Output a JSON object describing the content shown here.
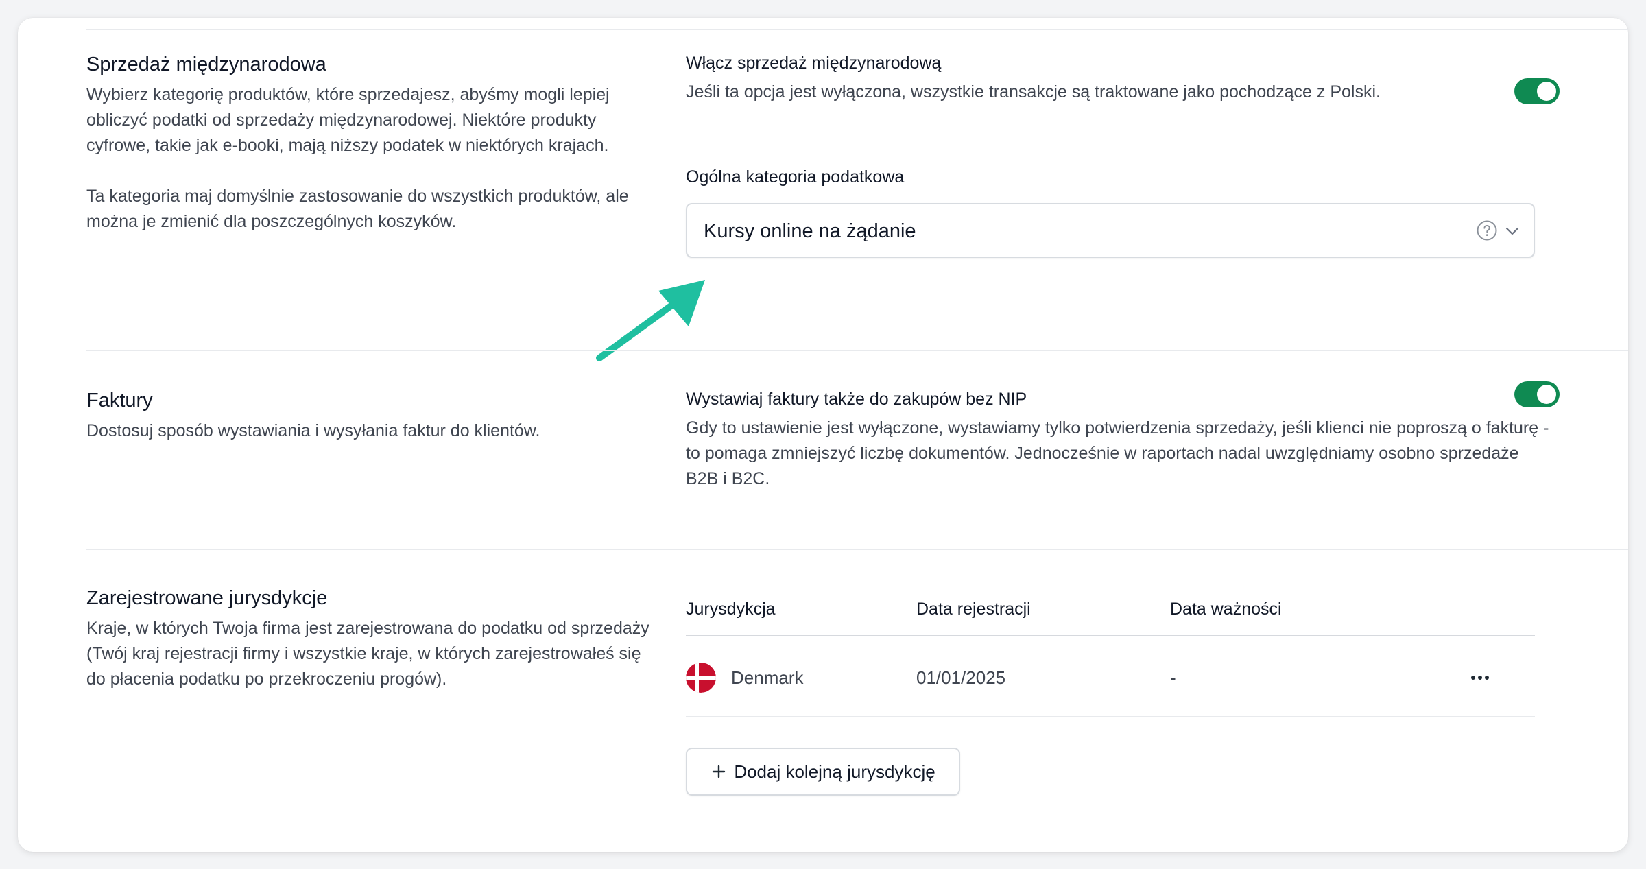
{
  "international": {
    "title": "Sprzedaż międzynarodowa",
    "description_1": "Wybierz kategorię produktów, które sprzedajesz, abyśmy mogli lepiej obliczyć podatki od sprzedaży międzynarodowej. Niektóre produkty cyfrowe, takie jak e-booki, mają niższy podatek w niektórych krajach.",
    "description_2": "Ta kategoria maj domyślnie zastosowanie do wszystkich produktów, ale można je zmienić dla poszczególnych koszyków.",
    "toggle_label": "Włącz sprzedaż międzynarodową",
    "toggle_description": "Jeśli ta opcja jest wyłączona, wszystkie transakcje są traktowane jako pochodzące z Polski.",
    "toggle_on": true,
    "category_label": "Ogólna kategoria podatkowa",
    "category_value": "Kursy online na żądanie"
  },
  "invoices": {
    "title": "Faktury",
    "description": "Dostosuj sposób wystawiania i wysyłania faktur do klientów.",
    "toggle_label": "Wystawiaj faktury także do zakupów bez NIP",
    "toggle_description": "Gdy to ustawienie jest wyłączone, wystawiamy tylko potwierdzenia sprzedaży, jeśli klienci nie poproszą o fakturę - to pomaga zmniejszyć liczbę dokumentów. Jednocześnie w raportach nadal uwzględniamy osobno sprzedaże B2B i B2C.",
    "toggle_on": true
  },
  "jurisdictions": {
    "title": "Zarejestrowane jurysdykcje",
    "description": "Kraje, w których Twoja firma jest zarejestrowana do podatku od sprzedaży (Twój kraj rejestracji firmy i wszystkie kraje, w których zarejestrowałeś się do płacenia podatku po przekroczeniu progów).",
    "columns": [
      "Jurysdykcja",
      "Data rejestracji",
      "Data ważności"
    ],
    "rows": [
      {
        "country": "Denmark",
        "registered": "01/01/2025",
        "expires": "-",
        "flag_icon": "denmark-flag-icon"
      }
    ],
    "add_button_label": "Dodaj kolejną jurysdykcję"
  },
  "colors": {
    "toggle_on": "#0f8a52",
    "annotation_arrow": "#1fbfa0",
    "divider": "#e8eaed"
  },
  "icons": {
    "help": "question-circle-icon",
    "dropdown": "chevron-down-icon",
    "more": "more-horizontal-icon",
    "add": "plus-icon",
    "annotation": "annotation-arrow-icon"
  }
}
